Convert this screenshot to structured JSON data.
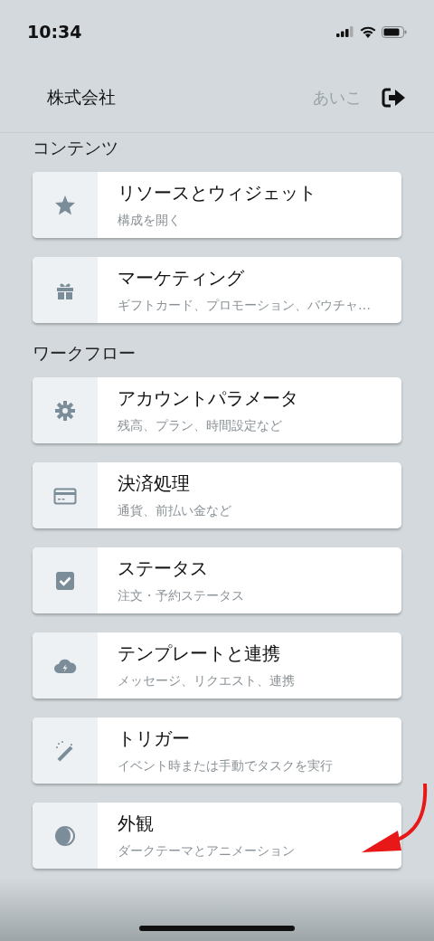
{
  "status_bar": {
    "time": "10:34"
  },
  "header": {
    "title": "株式会社",
    "user": "あいこ"
  },
  "sections": [
    {
      "title": "コンテンツ",
      "items": [
        {
          "kind": "star",
          "title": "リソースとウィジェット",
          "subtitle": "構成を開く"
        },
        {
          "kind": "gift",
          "title": "マーケティング",
          "subtitle": "ギフトカード、プロモーション、バウチャ…"
        }
      ]
    },
    {
      "title": "ワークフロー",
      "items": [
        {
          "kind": "gear",
          "title": "アカウントパラメータ",
          "subtitle": "残高、プラン、時間設定など"
        },
        {
          "kind": "card",
          "title": "決済処理",
          "subtitle": "通貨、前払い金など"
        },
        {
          "kind": "checkbox",
          "title": "ステータス",
          "subtitle": "注文・予約ステータス"
        },
        {
          "kind": "cloud",
          "title": "テンプレートと連携",
          "subtitle": "メッセージ、リクエスト、連携"
        },
        {
          "kind": "wand",
          "title": "トリガー",
          "subtitle": "イベント時または手動でタスクを実行"
        },
        {
          "kind": "contrast",
          "title": "外観",
          "subtitle": "ダークテーマとアニメーション"
        }
      ]
    }
  ]
}
